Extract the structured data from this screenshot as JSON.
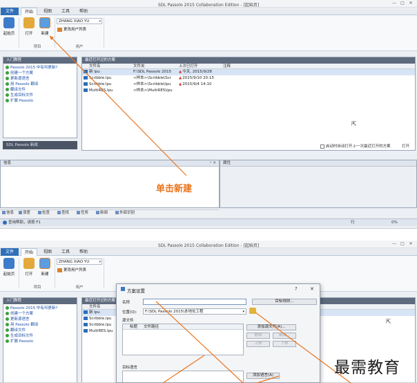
{
  "app": {
    "title": "SDL Passolo 2015 Collaboration Edition - [起始页]",
    "window_controls": [
      "—",
      "□",
      "✕"
    ]
  },
  "ribbon_tabs": [
    "文件",
    "开始",
    "视图",
    "工具",
    "帮助"
  ],
  "ribbon": {
    "start_page": "起始页",
    "open": "打开",
    "new": "新建",
    "group_project": "项目",
    "user_name": "ZHANG XIAO YU",
    "change_user_list": "更改用户列表",
    "group_user": "用户"
  },
  "getting_started": {
    "title": "入门教程",
    "links": [
      "Passolo 2015 中有何更新?",
      "创建一个方案",
      "更新源语言",
      "用 Passolo 翻译",
      "翻译文件",
      "生成目标文件",
      "扩展 Passolo"
    ],
    "news_title": "SDL Passolo 新闻"
  },
  "recent_projects": {
    "title": "最近打开过的方案",
    "columns": [
      "文件名",
      "文件夹",
      "上次已打开",
      "注释"
    ],
    "rows": [
      {
        "name": "新 lpu",
        "folder": "F:\\SDL Passolo 2015",
        "opened": "今天, 2015/9/28",
        "selected": true
      },
      {
        "name": "Scribble.lpu",
        "folder": "<样本>\\Scribble\\Scr",
        "opened": "2015/9/10 20:15",
        "selected": false
      },
      {
        "name": "Scribble.lpu",
        "folder": "<样本>\\Scribble\\lpu",
        "opened": "2015/9/4 14:10",
        "selected": false
      },
      {
        "name": "MultiRES.lpu",
        "folder": "<样本>\\MultiRES\\lpu",
        "opened": "",
        "selected": false
      }
    ],
    "auto_open_label": "启动时自动打开上一次最近打开的方案",
    "open_button": "打开"
  },
  "info_panel": {
    "title": "信息",
    "pin": "ᵖ ✕",
    "properties_title": "属性"
  },
  "bottom_tabs": [
    "信息",
    "误差",
    "检查",
    "查找",
    "任务",
    "新闻",
    "外部识别"
  ],
  "status": {
    "help": "查询帮助，请按 F1",
    "row": "行",
    "zoom": "0%"
  },
  "annotation": {
    "click_new": "单击新建"
  },
  "watermark": "最需教育",
  "dialog": {
    "title": "方案设置",
    "help": "?",
    "close": "✕",
    "name_label": "名称",
    "name_value": "",
    "location_label": "位置(O):",
    "location_value": "F:\\SDL Passolo 2015\\本地化工程",
    "target_rule_button": "目标规则...",
    "source_files_label": "源文件",
    "source_columns": [
      "标题",
      "文件路径"
    ],
    "add_source_file": "添加源文件(A)...",
    "remove": "删除",
    "edit": "编辑...",
    "move_up": "上移",
    "move_down": "下移",
    "target_language_label": "目标语言",
    "add_language": "添加语言(A)"
  }
}
